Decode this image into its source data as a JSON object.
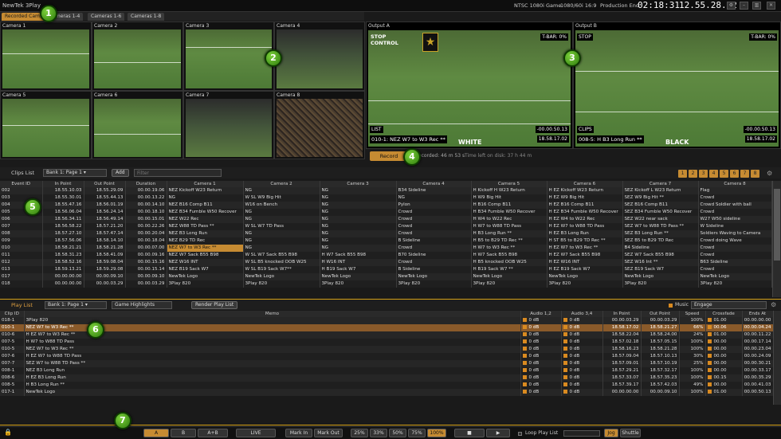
{
  "titlebar": {
    "app_title": "NewTek 3Play",
    "format": "NTSC 1080i Game",
    "aspect": "1080/60i 16:9",
    "production_label": "Production End",
    "production_time": "02:18:31",
    "clock": "12.55.28.12"
  },
  "tabs": [
    "Recorded Cams",
    "Cameras 1-4",
    "Cameras 1-6",
    "Cameras 1-8"
  ],
  "cameras": [
    "Camera 1",
    "Camera 2",
    "Camera 3",
    "Camera 4",
    "Camera 5",
    "Camera 6",
    "Camera 7",
    "Camera 8"
  ],
  "output_a": {
    "label": "Output A",
    "stop_control": "STOP\nCONTROL",
    "tbar": "T-BAR: 0%",
    "list_label": "LIST",
    "clip_name": "010-1: NEZ W7 to W3 Rec **",
    "time1": "-00.00.50.13",
    "time2": "18.58.17.02",
    "team": "WHITE"
  },
  "output_b": {
    "label": "Output B",
    "stop": "STOP",
    "tbar": "T-BAR: 0%",
    "list_label": "CLIPS",
    "clip_name": "008-5: H B3 Long Run **",
    "time1": "-00.00.50.13",
    "time2": "18.58.17.02",
    "team": "BLACK"
  },
  "record": {
    "button": "Record",
    "recorded": "Recorded: 46 m 53 s",
    "disk": "Time left on disk: 37 h 44 m"
  },
  "clips_toolbar": {
    "title": "Clips List",
    "bank": "Bank 1: Page 1",
    "add": "Add",
    "filter_placeholder": "Filter",
    "pages": [
      "1",
      "2",
      "3",
      "4",
      "5",
      "6",
      "7",
      "8"
    ]
  },
  "clips_columns": [
    "Event ID",
    "In Point",
    "Out Point",
    "Duration",
    "Camera 1",
    "Camera 2",
    "Camera 3",
    "Camera 4",
    "Camera 5",
    "Camera 6",
    "Camera 7",
    "Camera 8"
  ],
  "clips_rows": [
    [
      "002",
      "18.55.10.03",
      "18.55.29.09",
      "00.00.19.06",
      "NEZ Kickoff W23 Return",
      "NG",
      "NG",
      "B34 Sideline",
      "H Kickoff H W23 Return",
      "H EZ Kickoff W23 Return",
      "SEZ Kickoff L W23 Return",
      "Flag"
    ],
    [
      "003",
      "18.55.30.01",
      "18.55.44.13",
      "00.00.13.22",
      "NG",
      "W SL W9 Big Hit",
      "NG",
      "NG",
      "H W9 Big Hit",
      "H EZ W9 Big Hit",
      "SEZ W9 Big Hit **",
      "Crowd"
    ],
    [
      "004",
      "18.55.47.16",
      "18.56.01.19",
      "00.00.14.10",
      "NEZ B16 Comp B11",
      "W16 on Bench",
      "NG",
      "Pylon",
      "H B16 Comp B11",
      "H EZ B16 Comp B11",
      "SEZ B16 Comp B11",
      "Crowd Soldier with ball"
    ],
    [
      "005",
      "18.56.06.04",
      "18.56.24.14",
      "00.00.18.10",
      "NEZ B34 Fumble W50 Recover",
      "NG",
      "NG",
      "Crowd",
      "H B34 Fumble W50 Recover",
      "H EZ B34 Fumble W50 Recover",
      "SEZ B34 Fumble W50 Recover",
      "Crowd"
    ],
    [
      "006",
      "18.56.34.11",
      "18.56.49.14",
      "00.00.15.01",
      "NEZ W22 Rec",
      "NG",
      "NG",
      "Crowd",
      "H W4 to W22 Rec",
      "H EZ W4 to W22 Rec",
      "SEZ W22 near sack",
      "W27 W50 sideline"
    ],
    [
      "007",
      "18.56.58.22",
      "18.57.21.20",
      "00.00.22.26",
      "NEZ W88 TD Pass **",
      "W SL W7 TD Pass",
      "NG",
      "Crowd",
      "H W7 to W88 TD Pass",
      "H EZ W7 to W88 TD Pass",
      "SEZ W7 to W88 TD Pass **",
      "W Sideline"
    ],
    [
      "008",
      "18.57.27.10",
      "18.57.47.14",
      "00.00.20.04",
      "NEZ B3 Long Run",
      "NG",
      "NG",
      "Crowd",
      "H B3 Long Run **",
      "H EZ B3 Long Run",
      "SEZ B3 Long Run **",
      "Soldiers Waving to Camera"
    ],
    [
      "009",
      "18.57.56.06",
      "18.58.14.10",
      "00.00.18.04",
      "NEZ B29 TD Rec",
      "NG",
      "NG",
      "B Sideline",
      "H B5 to B29 TD Rec **",
      "H ST B5 to B29 TD Rec **",
      "SEZ B5 to B29 TD Rec",
      "Crowd doing Wave"
    ],
    [
      "010",
      "18.58.21.21",
      "18.58.21.28",
      "00.00.07.00",
      "NEZ W7 to W3 Rec **",
      "NG",
      "NG",
      "Crowd",
      "H W7 to W3 Rec **",
      "H EZ W7 to W3 Rec **",
      "B4 Sideline",
      "Crowd"
    ],
    [
      "011",
      "18.58.31.23",
      "18.58.41.09",
      "00.00.09.16",
      "NEZ W7 Sack  B55 B98",
      "W SL W7 Sack  B55 B98",
      "H W7 Sack  B55 B98",
      "B70 Sideline",
      "H W7 Sack  B55 B98",
      "H EZ W7 Sack  B55 B98",
      "SEZ W7 Sack  B55 B98",
      "Crowd"
    ],
    [
      "012",
      "18.58.52.16",
      "18.59.08.04",
      "00.00.15.16",
      "NEZ W16 INT",
      "W SL B5 knocked OOB W25",
      "H W16 INT",
      "Crowd",
      "H B5 knocked OOB W25",
      "H EZ W16 INT",
      "SEZ W16 Int **",
      "B63 Sideline"
    ],
    [
      "013",
      "18.59.13.21",
      "18.59.29.08",
      "00.00.15.14",
      "NEZ B19 Sack W7",
      "W SL B19 Sack W7**",
      "H B19 Sack W7",
      "B Sideline",
      "H B19 Sack W7 **",
      "H EZ B19 Sack W7",
      "SEZ B19 Sack W7",
      "Crowd"
    ],
    [
      "017",
      "00.00.00.00",
      "00.00.09.10",
      "00.00.09.10",
      "NewTek Logo",
      "NewTek Logo",
      "NewTek Logo",
      "NewTek Logo",
      "NewTek Logo",
      "NewTek Logo",
      "NewTek Logo",
      "NewTek Logo"
    ],
    [
      "018",
      "00.00.00.00",
      "00.00.03.29",
      "00.00.03.29",
      "3Play 820",
      "3Play 820",
      "3Play 820",
      "3Play 820",
      "3Play 820",
      "3Play 820",
      "3Play 820",
      "3Play 820"
    ]
  ],
  "playlist_toolbar": {
    "title": "Play List",
    "bank": "Bank 1: Page 1",
    "name": "Game Highlights",
    "render": "Render Play List",
    "music_label": "Music",
    "music_value": "Engage"
  },
  "playlist_columns": [
    "Clip ID",
    "Memo",
    "Audio 1,2",
    "Audio 3,4",
    "In Point",
    "Out Point",
    "Speed",
    "Crossfade",
    "Ends At"
  ],
  "playlist_rows": [
    [
      "018-1",
      "3Play 820",
      "0 dB",
      "0 dB",
      "00.00.03.29",
      "00.00.03.29",
      "100%",
      "01.00",
      "00.00.00.00"
    ],
    [
      "010-1",
      "NEZ W7 to W3 Rec **",
      "0 dB",
      "0 dB",
      "18.58.17.02",
      "18.58.21.27",
      "66%",
      "00.06",
      "00.00.04.24"
    ],
    [
      "010-6",
      "H EZ W7 to W3 Rec **",
      "0 dB",
      "0 dB",
      "18.58.22.04",
      "18.58.24.00",
      "24%",
      "01.00",
      "00.00.11.22"
    ],
    [
      "007-5",
      "H W7 to W88 TD Pass",
      "0 dB",
      "0 dB",
      "18.57.02.18",
      "18.57.05.15",
      "100%",
      "00.00",
      "00.00.17.14"
    ],
    [
      "010-5",
      "NEZ W7 to W3 Rec **",
      "0 dB",
      "0 dB",
      "18.58.16.23",
      "18.58.21.28",
      "100%",
      "00.00",
      "00.00.23.04"
    ],
    [
      "007-6",
      "H EZ W7 to W88 TD Pass",
      "0 dB",
      "0 dB",
      "18.57.09.04",
      "18.57.10.13",
      "30%",
      "00.00",
      "00.00.24.09"
    ],
    [
      "007-7",
      "SEZ W7 to W88 TD Pass **",
      "0 dB",
      "0 dB",
      "18.57.09.01",
      "18.57.10.19",
      "25%",
      "00.00",
      "00.00.30.21"
    ],
    [
      "008-1",
      "NEZ B3 Long Run",
      "0 dB",
      "0 dB",
      "18.57.29.21",
      "18.57.32.17",
      "100%",
      "00.00",
      "00.00.33.17"
    ],
    [
      "008-6",
      "H EZ B3 Long Run",
      "0 dB",
      "0 dB",
      "18.57.33.07",
      "18.57.35.23",
      "100%",
      "00.15",
      "00.00.35.29"
    ],
    [
      "008-5",
      "H B3 Long Run **",
      "0 dB",
      "0 dB",
      "18.57.39.17",
      "18.57.42.03",
      "49%",
      "00.00",
      "00.00.41.03"
    ],
    [
      "017-1",
      "NewTek Logo",
      "0 dB",
      "0 dB",
      "00.00.00.00",
      "00.00.09.10",
      "100%",
      "01.00",
      "00.00.50.13"
    ]
  ],
  "bottombar": {
    "buttons": [
      "A",
      "B",
      "A+B",
      "LIVE",
      "Mark In",
      "Mark Out",
      "25%",
      "33%",
      "50%",
      "75%",
      "100%"
    ],
    "loop": "Loop Play List",
    "jog": "Jog",
    "shuttle": "Shuttle"
  },
  "markers": [
    "1",
    "2",
    "3",
    "4",
    "5",
    "6",
    "7"
  ]
}
